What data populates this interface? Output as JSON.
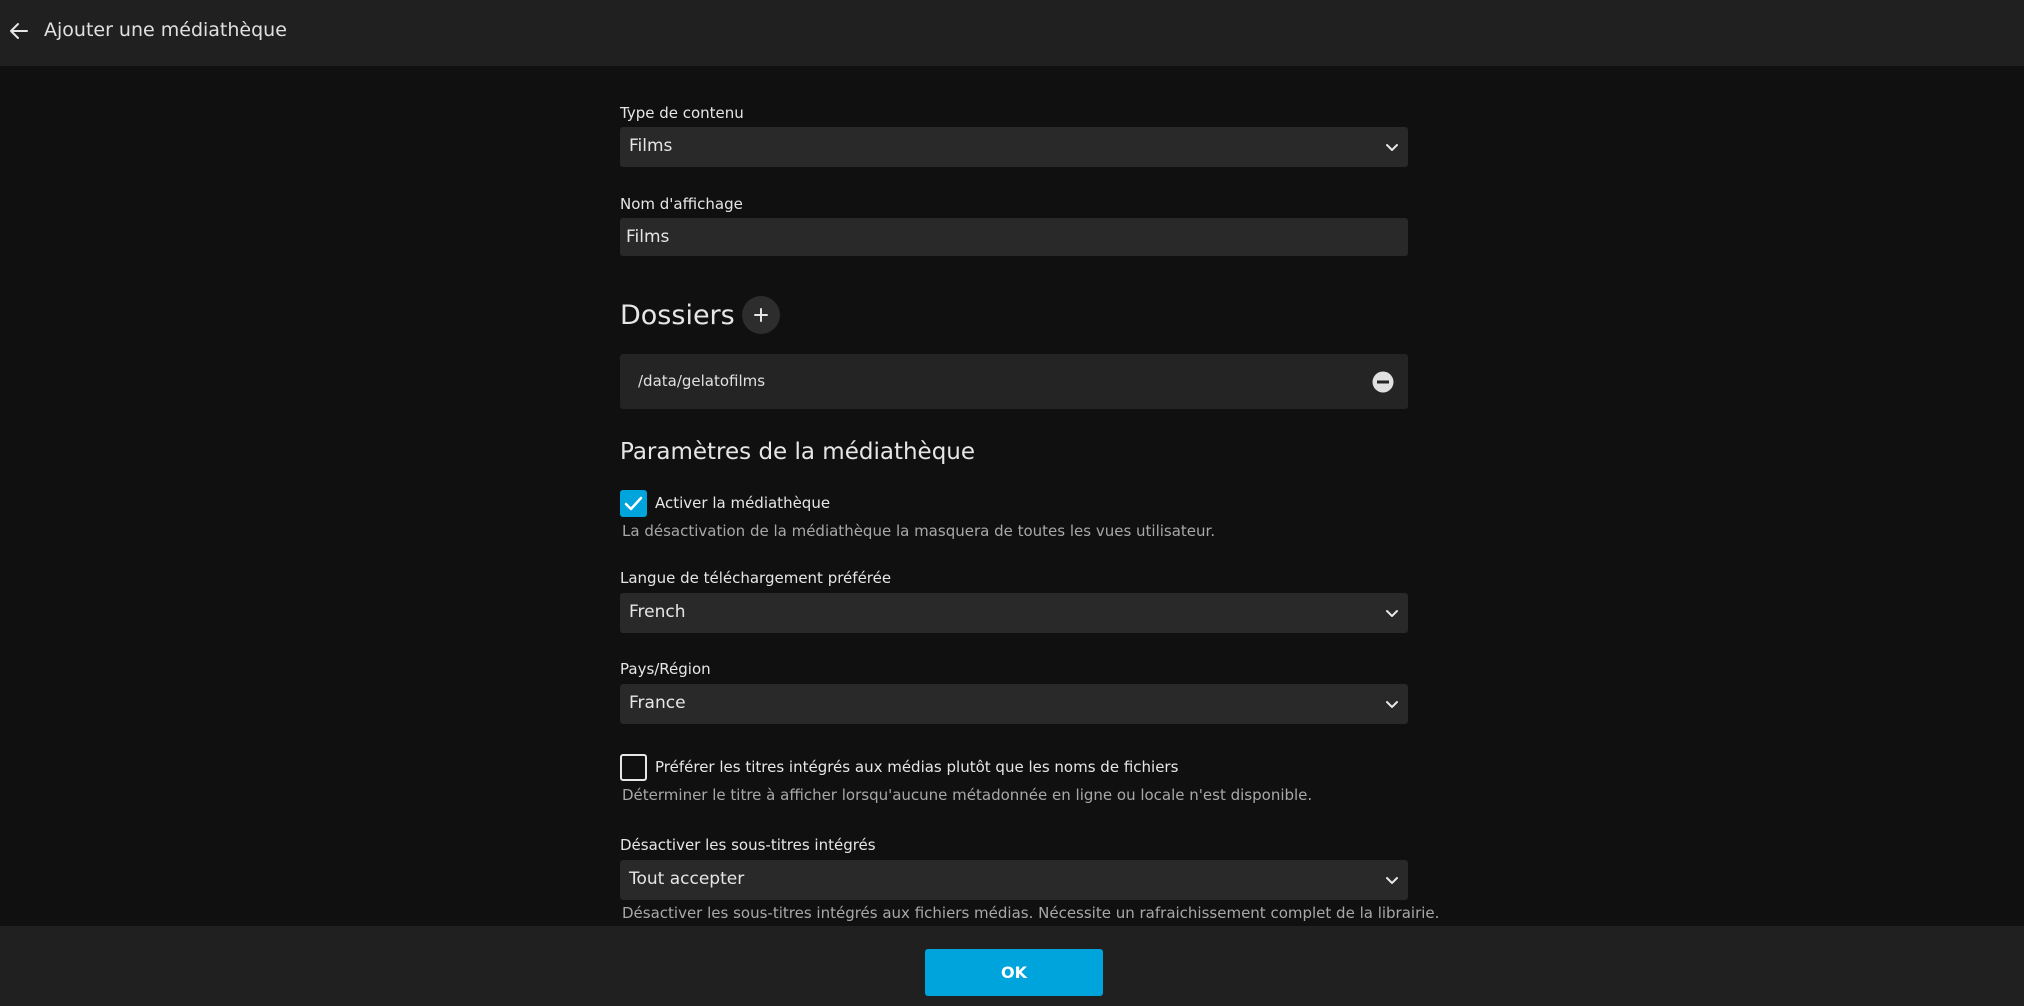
{
  "header": {
    "title": "Ajouter une médiathèque",
    "back_icon": "arrow-left-icon"
  },
  "content_type": {
    "label": "Type de contenu",
    "value": "Films"
  },
  "display_name": {
    "label": "Nom d'affichage",
    "value": "Films"
  },
  "folders": {
    "title": "Dossiers",
    "add_icon": "plus-icon",
    "items": [
      {
        "path": "/data/gelatofilms"
      }
    ]
  },
  "library_settings": {
    "title": "Paramètres de la médiathèque",
    "enable": {
      "label": "Activer la médiathèque",
      "checked": true,
      "help": "La désactivation de la médiathèque la masquera de toutes les vues utilisateur."
    },
    "language": {
      "label": "Langue de téléchargement préférée",
      "value": "French"
    },
    "country": {
      "label": "Pays/Région",
      "value": "France"
    },
    "prefer_embedded_titles": {
      "label": "Préférer les titres intégrés aux médias plutôt que les noms de fichiers",
      "checked": false,
      "help": "Déterminer le titre à afficher lorsqu'aucune métadonnée en ligne ou locale n'est disponible."
    },
    "disable_embedded_subtitles": {
      "label": "Désactiver les sous-titres intégrés",
      "value": "Tout accepter",
      "help": "Désactiver les sous-titres intégrés aux fichiers médias. Nécessite un rafraichissement complet de la librairie."
    }
  },
  "footer": {
    "ok_label": "OK"
  },
  "colors": {
    "accent": "#00a4dc",
    "background": "#101010",
    "bar": "#202020",
    "input": "#292929"
  }
}
